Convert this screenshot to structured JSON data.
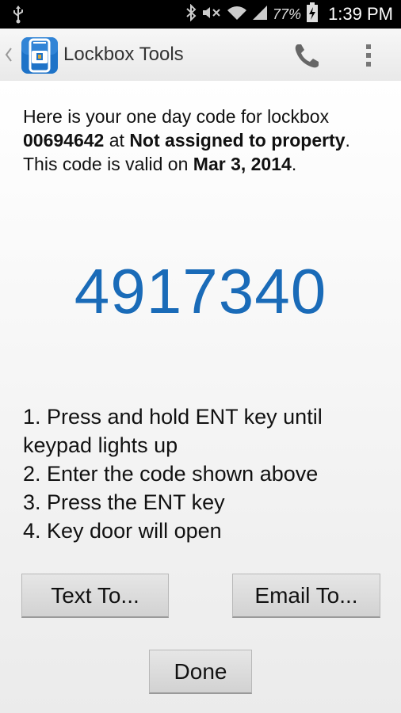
{
  "status_bar": {
    "battery_percent": "77%",
    "time": "1:39 PM"
  },
  "action_bar": {
    "title": "Lockbox Tools",
    "icons": [
      "lockbox-app-icon",
      "phone-icon",
      "overflow-menu-icon"
    ]
  },
  "message": {
    "prefix": "Here is your one day code for lockbox ",
    "lockbox_id": "00694642",
    "at_text": " at ",
    "property": "Not assigned to property",
    "period": ".",
    "valid_prefix": "This code is valid on ",
    "valid_date": "Mar 3, 2014",
    "valid_period": "."
  },
  "code": "4917340",
  "instructions": [
    "1. Press and hold ENT key until keypad lights up",
    "2. Enter the code shown above",
    "3. Press the ENT key",
    "4. Key door will open"
  ],
  "buttons": {
    "text_to": "Text To...",
    "email_to": "Email To...",
    "done": "Done"
  },
  "colors": {
    "code": "#1a6bb8",
    "app_icon": "#1e73c8"
  }
}
